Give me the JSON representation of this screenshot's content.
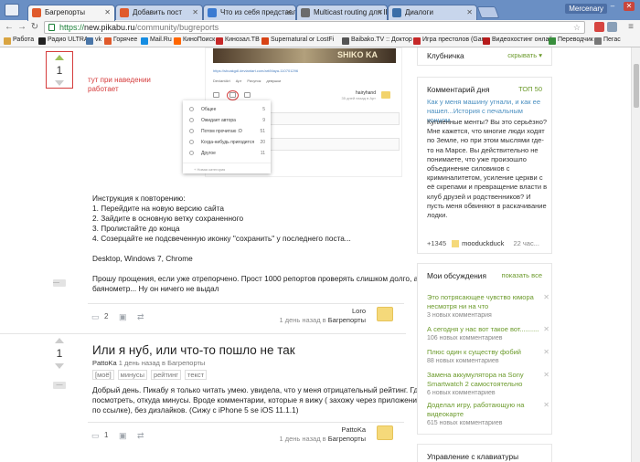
{
  "browser": {
    "tabs": [
      {
        "label": "Багрепорты",
        "color": "#e05a2b",
        "active": true
      },
      {
        "label": "Добавить пост",
        "color": "#e05a2b",
        "active": false
      },
      {
        "label": "Что из себя представляет",
        "color": "#3a7ad1",
        "active": false
      },
      {
        "label": "Multicast routing для IPT",
        "color": "#6b6b6b",
        "active": false
      },
      {
        "label": "Диалоги",
        "color": "#3a6ea8",
        "active": false
      }
    ],
    "user_badge": "Mercenary",
    "url_scheme": "https://",
    "url_host": "new.pikabu.ru",
    "url_path": "/community/bugreports",
    "bookmarks": [
      {
        "label": "Работа",
        "color": "#d9a441"
      },
      {
        "label": "Радио ULTRA",
        "color": "#222222"
      },
      {
        "label": "vk",
        "color": "#4a76a8"
      },
      {
        "label": "Горячее",
        "color": "#e05a2b"
      },
      {
        "label": "Mail.Ru",
        "color": "#168de2"
      },
      {
        "label": "КиноПоиск",
        "color": "#ff6600"
      },
      {
        "label": "Кинозал.ТВ",
        "color": "#c62828"
      },
      {
        "label": "Supernatural or LostFi",
        "color": "#d84315"
      },
      {
        "label": "Baibako.TV :: Доктор",
        "color": "#555555"
      },
      {
        "label": "Игра престолов (Gam",
        "color": "#c62828"
      },
      {
        "label": "Видеохостинг онлайн",
        "color": "#b71c1c"
      },
      {
        "label": "Переводчик",
        "color": "#388e3c"
      },
      {
        "label": "Пегас",
        "color": "#777777"
      }
    ]
  },
  "post1": {
    "score": "1",
    "hover_note": "тут при наведении работает",
    "screenshot": {
      "banner": "SHIKO KA",
      "link": "https://shoakgdl.deviantart.com/art/Maya-110701296",
      "tags": [
        "DeviantArt",
        "Арт",
        "Рисунок",
        "девушки"
      ],
      "author": "hairyhand",
      "author_meta": "35 дней назад в Арт",
      "popup": [
        {
          "label": "Общее",
          "count": "5"
        },
        {
          "label": "Ожидает автора",
          "count": "9"
        },
        {
          "label": "Потом прочитаю :D",
          "count": "51"
        },
        {
          "label": "Когда-нибудь пригодится",
          "count": "20"
        },
        {
          "label": "Другое",
          "count": "11"
        }
      ],
      "popup_new": "+ Новая категория"
    },
    "body": [
      "Инструкция к повторению:",
      "1. Перейдите на новую версию сайта",
      "2. Зайдите в основную ветку сохраненного",
      "3. Пролистайте до конца",
      "4. Созерцайте не подсвеченную иконку \"сохранить\" у последнего поста...",
      "",
      "Desktop, Windows 7, Chrome",
      "",
      "Прошу прощения, если уже отрепорчено. Прост 1000 репортов проверять слишком долго, а",
      "баянометр... Ну он ничего не выдал"
    ],
    "comments_count": "2",
    "author": "Loro",
    "meta_prefix": "1 день назад в ",
    "community": "Багрепорты"
  },
  "post2": {
    "score": "1",
    "title": "Или я нуб, или что-то пошло не так",
    "byline_author": "PattoKa",
    "byline_rest": " 1 день назад в Багрепорты",
    "tags": [
      "[моё]",
      "минусы",
      "рейтинг",
      "текст"
    ],
    "body": [
      "Добрый день. Пикабу я только читать умею. увидела, что у меня отрицательный рейтинг. Где",
      "посмотреть, откуда минусы. Вроде комментарии, которые я вижу ( захожу через приложение вк",
      "по ссылке), без дизлайков. (Сижу с iPhone 5 se iOS 11.1.1)"
    ],
    "comments_count": "1",
    "author": "PattoKa",
    "meta_prefix": "1 день назад в ",
    "community": "Багрепорты"
  },
  "sidebar": {
    "klubnichka": {
      "title": "Клубничка",
      "action": "скрывать ▾"
    },
    "comment_of_day": {
      "title": "Комментарий дня",
      "top": "ТОП 50",
      "post_title": "Как у меня машину угнали, и как ее нашел...История с печальным концом.",
      "body": "Купленные менты? Вы это серьёзно? Мне кажется, что многие люди ходят по Земле, но при этом мыслями где-то на Марсе. Вы действительно не понимаете, что уже произошло объединение силовиков с криминалитетом, усиление церкви с её скрепами и превращение власти в клуб друзей и родственников? И пусть меня обвиняют в раскачивание лодки.",
      "rating": "+1345",
      "author": "mooduckduck",
      "time": "22 час..."
    },
    "discussions": {
      "title": "Мои обсуждения",
      "action": "показать все",
      "items": [
        {
          "title": "Это потрясающее чувство юмора несмотря ни на что",
          "count": "3 новых комментария"
        },
        {
          "title": "А сегодня у нас вот такое вот..........",
          "count": "106 новых комментариев"
        },
        {
          "title": "Плюс один к существу фобий",
          "count": "88 новых комментариев"
        },
        {
          "title": "Замена аккумулятора на Sony Smartwatch 2 самостоятельно",
          "count": "6 новых комментариев"
        },
        {
          "title": "Доделал игру, работающую на видеокарте",
          "count": "615 новых комментариев"
        }
      ]
    },
    "keyboard": {
      "title": "Управление с клавиатуры"
    }
  }
}
